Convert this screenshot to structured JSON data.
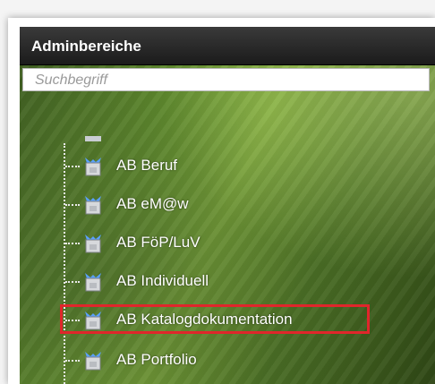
{
  "window": {
    "title": "Adminbereiche"
  },
  "search": {
    "placeholder": "Suchbegriff"
  },
  "tree": {
    "items": [
      {
        "label": "AB Beruf"
      },
      {
        "label": "AB eM@w"
      },
      {
        "label": "AB FöP/LuV"
      },
      {
        "label": "AB Individuell"
      },
      {
        "label": "AB Katalogdokumentation"
      },
      {
        "label": "AB Portfolio"
      }
    ],
    "icon": "folder-icon"
  },
  "colors": {
    "highlight": "#e0262b",
    "titlebar": "#1b1b1b"
  }
}
